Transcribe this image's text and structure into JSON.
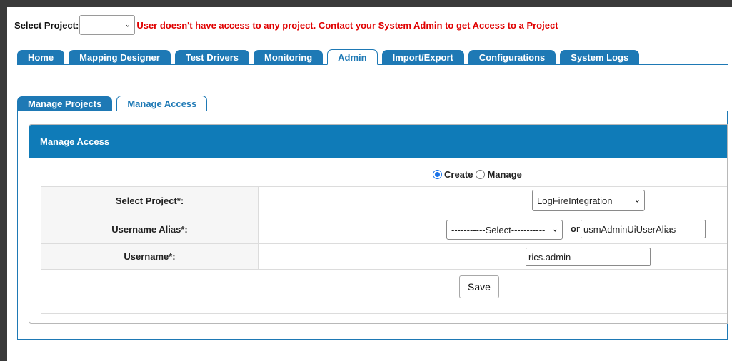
{
  "project_bar": {
    "label": "Select Project:",
    "selected": "",
    "warning": "User doesn't have access to any project. Contact your System Admin to get Access to a Project"
  },
  "main_tabs": [
    {
      "label": "Home",
      "active": false
    },
    {
      "label": "Mapping Designer",
      "active": false
    },
    {
      "label": "Test Drivers",
      "active": false
    },
    {
      "label": "Monitoring",
      "active": false
    },
    {
      "label": "Admin",
      "active": true
    },
    {
      "label": "Import/Export",
      "active": false
    },
    {
      "label": "Configurations",
      "active": false
    },
    {
      "label": "System Logs",
      "active": false
    }
  ],
  "sub_tabs": [
    {
      "label": "Manage Projects",
      "active": false
    },
    {
      "label": "Manage Access",
      "active": true
    }
  ],
  "panel": {
    "title": "Manage Access",
    "mode_options": {
      "create": "Create",
      "manage": "Manage",
      "selected": "create"
    },
    "fields": {
      "project_label": "Select Project*:",
      "project_value": "LogFireIntegration",
      "alias_label": "Username Alias*:",
      "alias_select_value": "-----------Select-----------",
      "alias_or": "or",
      "alias_text_value": "usmAdminUiUserAlias",
      "username_label": "Username*:",
      "username_value": "rics.admin"
    },
    "save_label": "Save"
  },
  "colors": {
    "accent": "#1e79b5",
    "header": "#0f7bb8",
    "warning": "#e00000"
  }
}
